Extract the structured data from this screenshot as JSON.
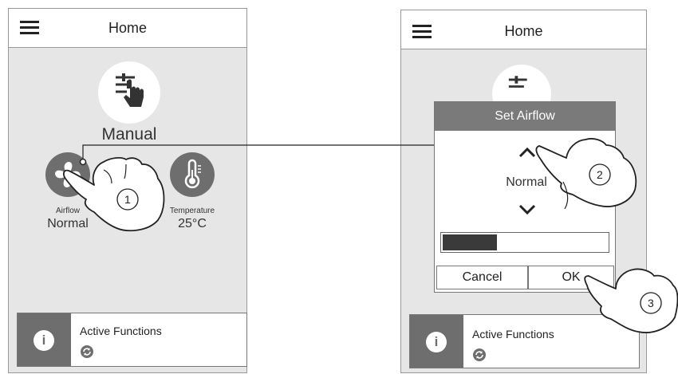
{
  "left_screen": {
    "header": {
      "title": "Home"
    },
    "mode": {
      "label": "Manual",
      "icon": "sliders-hand-icon"
    },
    "airflow": {
      "label": "Airflow",
      "value": "Normal",
      "icon": "fan-icon"
    },
    "temperature": {
      "label": "Temperature",
      "value": "25°C",
      "icon": "thermometer-icon"
    },
    "active_functions": {
      "title": "Active Functions"
    }
  },
  "right_screen": {
    "header": {
      "title": "Home"
    },
    "active_functions": {
      "title": "Active Functions"
    }
  },
  "dialog": {
    "title": "Set Airflow",
    "value": "Normal",
    "level": 0.33,
    "cancel_label": "Cancel",
    "ok_label": "OK"
  },
  "callouts": {
    "step1": "1",
    "step2": "2",
    "step3": "3"
  },
  "colors": {
    "screen_bg": "#e6e6e6",
    "icon_gray": "#6e6e6e",
    "dialog_header": "#7a7a7a",
    "bar_fill": "#3a3a3a"
  }
}
